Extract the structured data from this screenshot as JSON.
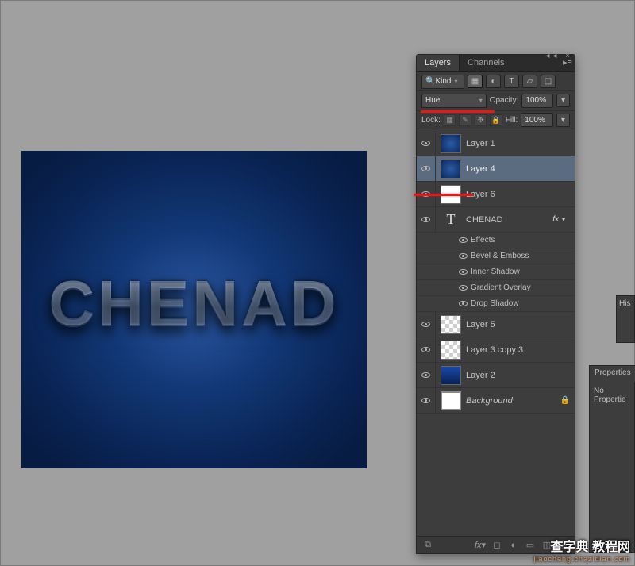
{
  "canvas": {
    "text": "CHENAD"
  },
  "panel": {
    "tabs": {
      "layers": "Layers",
      "channels": "Channels"
    },
    "filter": {
      "kind_label": "Kind"
    },
    "blend_mode": "Hue",
    "opacity": {
      "label": "Opacity:",
      "value": "100%"
    },
    "lock": {
      "label": "Lock:"
    },
    "fill": {
      "label": "Fill:",
      "value": "100%"
    }
  },
  "layers": [
    {
      "name": "Layer 1",
      "vis": true,
      "thumb": "dark"
    },
    {
      "name": "Layer 4",
      "vis": true,
      "thumb": "dark",
      "selected": true
    },
    {
      "name": "Layer 6",
      "vis": true,
      "thumb": "white"
    },
    {
      "name": "CHENAD",
      "vis": true,
      "thumb": "T",
      "fx": true,
      "effects_label": "Effects",
      "effects": [
        "Bevel & Emboss",
        "Inner Shadow",
        "Gradient Overlay",
        "Drop Shadow"
      ]
    },
    {
      "name": "Layer 5",
      "vis": true,
      "thumb": "checker"
    },
    {
      "name": "Layer 3 copy 3",
      "vis": true,
      "thumb": "checker"
    },
    {
      "name": "Layer 2",
      "vis": true,
      "thumb": "gradblue"
    },
    {
      "name": "Background",
      "vis": true,
      "thumb": "white",
      "locked": true,
      "bg": true
    }
  ],
  "history_panel": {
    "title": "His"
  },
  "properties_panel": {
    "title": "Properties",
    "body": "No Propertie"
  },
  "watermark": {
    "main": "查字典 教程网",
    "sub": "jiaocheng.chazidian.com"
  }
}
